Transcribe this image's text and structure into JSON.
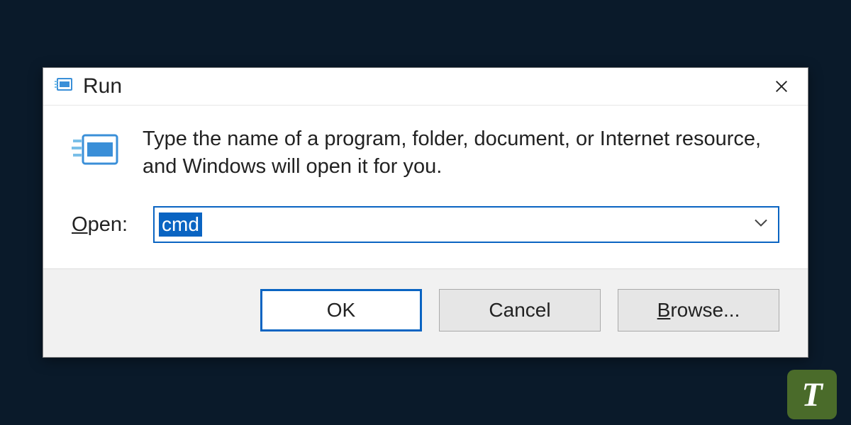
{
  "dialog": {
    "title": "Run",
    "description": "Type the name of a program, folder, document, or Internet resource, and Windows will open it for you.",
    "open_label_prefix": "O",
    "open_label_rest": "pen:",
    "input_value": "cmd",
    "buttons": {
      "ok": "OK",
      "cancel": "Cancel",
      "browse_prefix": "B",
      "browse_rest": "rowse..."
    }
  },
  "watermark": "T"
}
